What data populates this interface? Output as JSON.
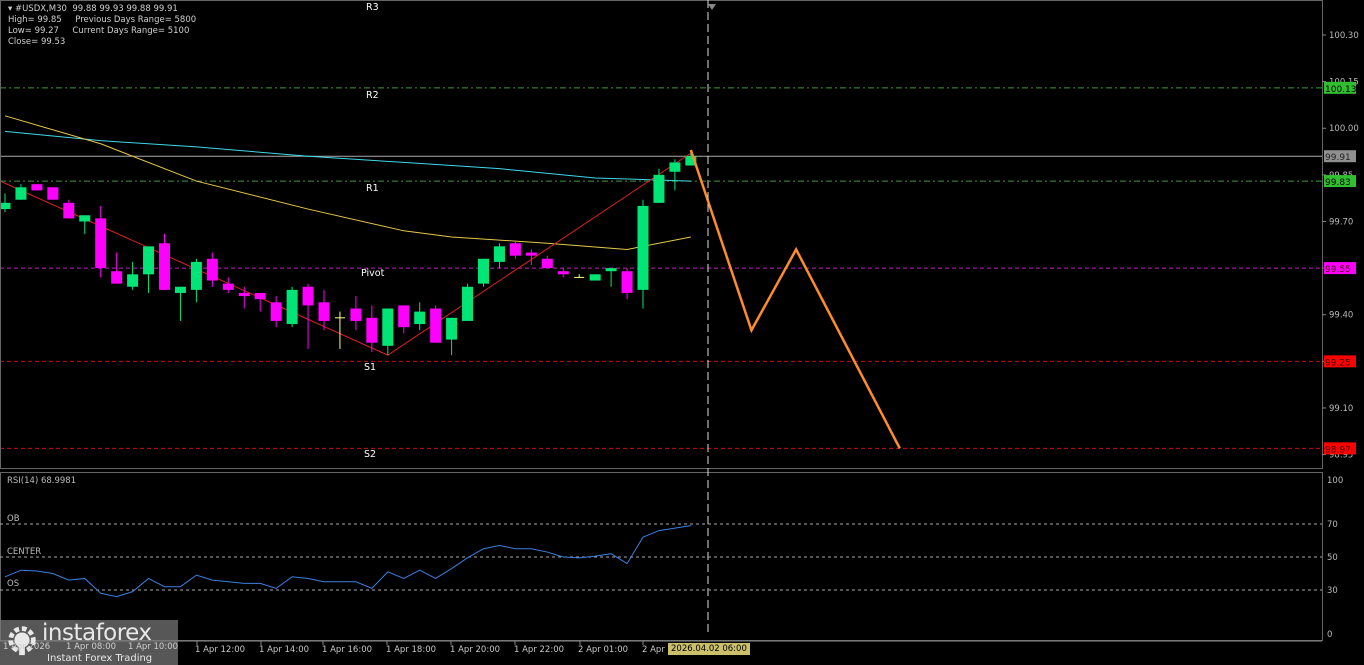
{
  "header": {
    "symbol_line": "#USDX,M30  99.88 99.93 99.88 99.91",
    "high": "High= 99.85",
    "prev_range": "Previous Days Range= 5800",
    "low": "Low= 99.27",
    "curr_range": "Current Days Range= 5100",
    "close": "Close= 99.53"
  },
  "levels": [
    {
      "label": "R3",
      "price": null,
      "color": "#3c9a3c"
    },
    {
      "label": "R2",
      "price": 100.13,
      "tag": "100.13",
      "color": "#2fbf2f"
    },
    {
      "label": "R1",
      "price": 99.83,
      "tag": "99.83",
      "color": "#2fbf2f"
    },
    {
      "label": "Pivot",
      "price": 99.55,
      "tag": "99.55",
      "color": "#ff00ff"
    },
    {
      "label": "S1",
      "price": 99.25,
      "tag": "99.25",
      "color": "#ff0000"
    },
    {
      "label": "S2",
      "price": 98.97,
      "tag": "98.97",
      "color": "#ff0000"
    }
  ],
  "current_price": {
    "price": 99.91,
    "tag": "99.91",
    "color": "#909090"
  },
  "price_axis": {
    "min": 98.94,
    "max": 100.41,
    "ticks": [
      "100.30",
      "100.15",
      "100.00",
      "99.85",
      "99.70",
      "99.55",
      "99.40",
      "99.25",
      "99.10",
      "98.95"
    ]
  },
  "colors": {
    "bull": "#00e676",
    "bear": "#ff00ff",
    "doji": "#ffff80",
    "ma_fast": "#e6c84a",
    "ma_slow": "#40d8e8",
    "zigzag": "#e02020",
    "forecast": "#ff8c2a",
    "rsi": "#3d7fe0"
  },
  "candles": [
    [
      99.74,
      99.79,
      99.73,
      99.76
    ],
    [
      99.77,
      99.82,
      99.77,
      99.81
    ],
    [
      99.82,
      99.82,
      99.8,
      99.8
    ],
    [
      99.81,
      99.81,
      99.77,
      99.77
    ],
    [
      99.76,
      99.77,
      99.71,
      99.71
    ],
    [
      99.7,
      99.72,
      99.66,
      99.72
    ],
    [
      99.71,
      99.75,
      99.52,
      99.55
    ],
    [
      99.54,
      99.6,
      99.5,
      99.5
    ],
    [
      99.49,
      99.57,
      99.48,
      99.53
    ],
    [
      99.53,
      99.62,
      99.47,
      99.62
    ],
    [
      99.63,
      99.66,
      99.48,
      99.48
    ],
    [
      99.47,
      99.49,
      99.38,
      99.49
    ],
    [
      99.48,
      99.58,
      99.44,
      99.57
    ],
    [
      99.58,
      99.6,
      99.49,
      99.51
    ],
    [
      99.5,
      99.52,
      99.47,
      99.48
    ],
    [
      99.47,
      99.49,
      99.42,
      99.46
    ],
    [
      99.47,
      99.47,
      99.41,
      99.45
    ],
    [
      99.44,
      99.46,
      99.36,
      99.38
    ],
    [
      99.37,
      99.49,
      99.36,
      99.48
    ],
    [
      99.49,
      99.5,
      99.29,
      99.43
    ],
    [
      99.44,
      99.48,
      99.35,
      99.38
    ],
    [
      99.39,
      99.41,
      99.29,
      99.39
    ],
    [
      99.42,
      99.46,
      99.35,
      99.38
    ],
    [
      99.39,
      99.43,
      99.28,
      99.31
    ],
    [
      99.3,
      99.42,
      99.27,
      99.42
    ],
    [
      99.43,
      99.43,
      99.34,
      99.36
    ],
    [
      99.37,
      99.44,
      99.35,
      99.41
    ],
    [
      99.42,
      99.43,
      99.31,
      99.31
    ],
    [
      99.32,
      99.39,
      99.27,
      99.39
    ],
    [
      99.38,
      99.5,
      99.38,
      99.49
    ],
    [
      99.5,
      99.58,
      99.49,
      99.58
    ],
    [
      99.57,
      99.63,
      99.55,
      99.62
    ],
    [
      99.63,
      99.64,
      99.58,
      99.59
    ],
    [
      99.6,
      99.61,
      99.56,
      99.59
    ],
    [
      99.58,
      99.59,
      99.55,
      99.55
    ],
    [
      99.54,
      99.55,
      99.52,
      99.53
    ],
    [
      99.52,
      99.53,
      99.52,
      99.52
    ],
    [
      99.51,
      99.53,
      99.51,
      99.53
    ],
    [
      99.54,
      99.55,
      99.49,
      99.55
    ],
    [
      99.54,
      99.55,
      99.45,
      99.47
    ],
    [
      99.48,
      99.77,
      99.42,
      99.75
    ],
    [
      99.76,
      99.87,
      99.76,
      99.85
    ],
    [
      99.86,
      99.9,
      99.8,
      99.89
    ],
    [
      99.88,
      99.93,
      99.88,
      99.91
    ]
  ],
  "ma_slow": [
    [
      0,
      99.99
    ],
    [
      6,
      99.96
    ],
    [
      12,
      99.94
    ],
    [
      19,
      99.91
    ],
    [
      25,
      99.89
    ],
    [
      31,
      99.87
    ],
    [
      37,
      99.84
    ],
    [
      43,
      99.83
    ]
  ],
  "ma_fast": [
    [
      0,
      100.04
    ],
    [
      6,
      99.95
    ],
    [
      12,
      99.83
    ],
    [
      19,
      99.74
    ],
    [
      25,
      99.67
    ],
    [
      28,
      99.65
    ],
    [
      34,
      99.63
    ],
    [
      39,
      99.61
    ],
    [
      43,
      99.65
    ]
  ],
  "zigzag": [
    [
      -0.3,
      99.83
    ],
    [
      24,
      99.27
    ],
    [
      43,
      99.92
    ]
  ],
  "forecast": [
    [
      43,
      99.93
    ],
    [
      46.8,
      99.35
    ],
    [
      49.6,
      99.61
    ],
    [
      56.1,
      98.97
    ]
  ],
  "rsi": {
    "label": "RSI(14) 68.9981",
    "levels": [
      {
        "name": "OB",
        "value": 70
      },
      {
        "name": "CENTER",
        "value": 50
      },
      {
        "name": "OS",
        "value": 30
      }
    ],
    "axis_ticks": [
      "100",
      "70",
      "50",
      "30",
      "0"
    ],
    "values": [
      38,
      42,
      41.5,
      40,
      36,
      37,
      28,
      26,
      29,
      37,
      32,
      32,
      39,
      36,
      35,
      34,
      34,
      31,
      38,
      37,
      35,
      35,
      35,
      31,
      41,
      37,
      42,
      37,
      43,
      49.5,
      55,
      57,
      55,
      55,
      53,
      50,
      49.5,
      50.5,
      52,
      46,
      62,
      66,
      67.5,
      69
    ]
  },
  "time_axis": {
    "hidden_labels": [
      "1 Apr 2026",
      "1 Apr 08:00",
      "1 Apr 10:00"
    ],
    "labels": [
      "1 Apr 12:00",
      "1 Apr 14:00",
      "1 Apr 16:00",
      "1 Apr 18:00",
      "1 Apr 20:00",
      "1 Apr 22:00",
      "2 Apr 01:00",
      "2 Apr"
    ],
    "cursor_time": "2026.04.02 06:00"
  },
  "logo": {
    "brand": "instaforex",
    "tagline": "Instant Forex Trading"
  }
}
